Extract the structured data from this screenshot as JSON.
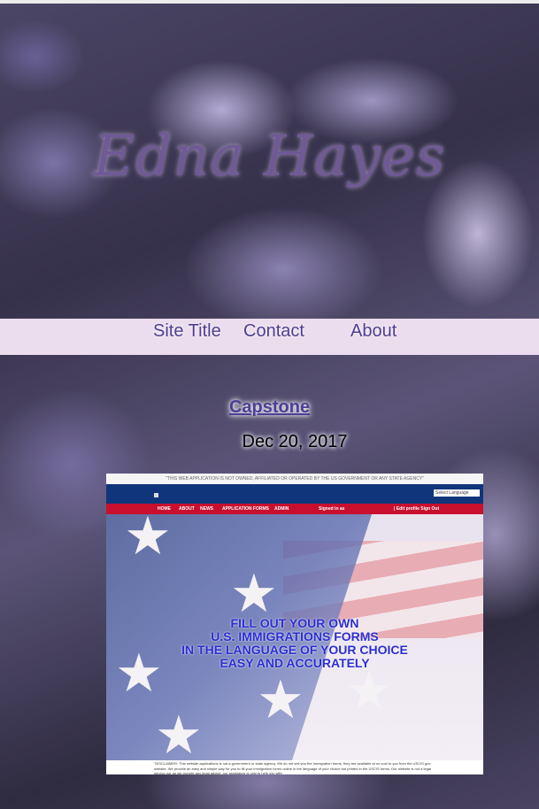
{
  "site": {
    "title": "Edna Hayes"
  },
  "nav": {
    "items": [
      "Site Title",
      "Contact",
      "About"
    ]
  },
  "post": {
    "title": "Capstone",
    "date": "Dec 20, 2017"
  },
  "screenshot": {
    "top_disclaimer": "\"THIS WEB APPLICATION IS NOT OWNED, AFFILIATED OR OPERATED BY THE US GOVERNMENT OR ANY STATE AGENCY\"",
    "language_select": "Select Language",
    "menu": [
      "HOME",
      "ABOUT",
      "NEWS",
      "APPLICATION FORMS",
      "ADMIN"
    ],
    "signed_in": "Signed in as",
    "account": "| Edit profile   Sign Out",
    "hero_lines": [
      "FILL OUT YOUR OWN",
      "U.S. IMMIGRATIONS FORMS",
      "IN THE LANGUAGE OF YOUR CHOICE",
      "EASY AND ACCURATELY"
    ],
    "bottom_disclaimer": "\"DISCLAIMER: This website applications is not a government or state agency. We do not sell you the Immigration forms, they are available at no cost to you from the USCIS.gov website. We provide an easy and simple way for you to fill your immigration forms online in the language of your choice but printed in the USCIS forms. Our website is not a legal service nor do we provide any legal advice, our assistance is only to help you with"
  },
  "colors": {
    "nav_bg": "#ebdcee",
    "nav_text": "#4e3f8f",
    "title": "#6f5a95"
  }
}
